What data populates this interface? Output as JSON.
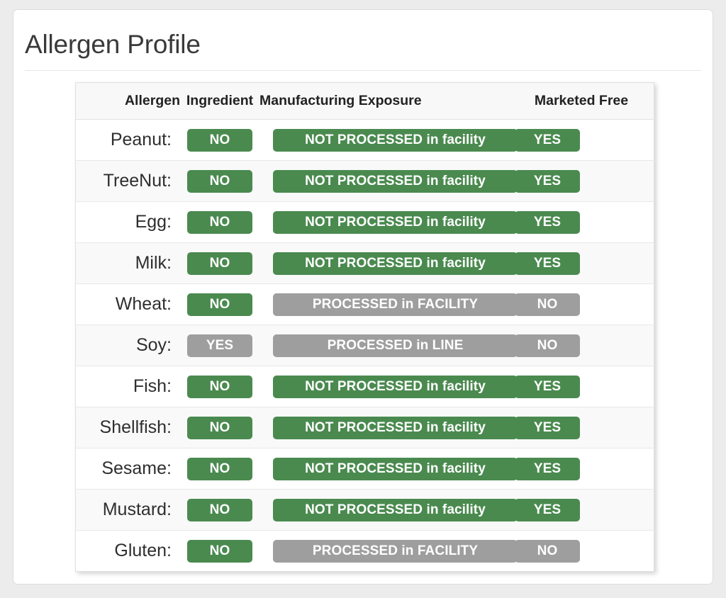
{
  "card": {
    "title": "Allergen Profile"
  },
  "table": {
    "headers": {
      "allergen": "Allergen",
      "ingredient": "Ingredient",
      "exposure": "Manufacturing Exposure",
      "marketed": "Marketed Free"
    },
    "colors": {
      "green": "#4a8a4f",
      "gray": "#9e9e9e",
      "header_bg": "#f8f8f8",
      "stripe_bg": "#f9f9f9",
      "page_bg": "#ececec",
      "card_bg": "#ffffff",
      "title_color": "#3a3a3a"
    },
    "rows": [
      {
        "allergen": "Peanut:",
        "ingredient": "NO",
        "ingredient_state": "green",
        "exposure": "NOT PROCESSED in facility",
        "exposure_state": "green",
        "marketed": "YES",
        "marketed_state": "green"
      },
      {
        "allergen": "TreeNut:",
        "ingredient": "NO",
        "ingredient_state": "green",
        "exposure": "NOT PROCESSED in facility",
        "exposure_state": "green",
        "marketed": "YES",
        "marketed_state": "green"
      },
      {
        "allergen": "Egg:",
        "ingredient": "NO",
        "ingredient_state": "green",
        "exposure": "NOT PROCESSED in facility",
        "exposure_state": "green",
        "marketed": "YES",
        "marketed_state": "green"
      },
      {
        "allergen": "Milk:",
        "ingredient": "NO",
        "ingredient_state": "green",
        "exposure": "NOT PROCESSED in facility",
        "exposure_state": "green",
        "marketed": "YES",
        "marketed_state": "green"
      },
      {
        "allergen": "Wheat:",
        "ingredient": "NO",
        "ingredient_state": "green",
        "exposure": "PROCESSED in FACILITY",
        "exposure_state": "gray",
        "marketed": "NO",
        "marketed_state": "gray"
      },
      {
        "allergen": "Soy:",
        "ingredient": "YES",
        "ingredient_state": "gray",
        "exposure": "PROCESSED in LINE",
        "exposure_state": "gray",
        "marketed": "NO",
        "marketed_state": "gray"
      },
      {
        "allergen": "Fish:",
        "ingredient": "NO",
        "ingredient_state": "green",
        "exposure": "NOT PROCESSED in facility",
        "exposure_state": "green",
        "marketed": "YES",
        "marketed_state": "green"
      },
      {
        "allergen": "Shellfish:",
        "ingredient": "NO",
        "ingredient_state": "green",
        "exposure": "NOT PROCESSED in facility",
        "exposure_state": "green",
        "marketed": "YES",
        "marketed_state": "green"
      },
      {
        "allergen": "Sesame:",
        "ingredient": "NO",
        "ingredient_state": "green",
        "exposure": "NOT PROCESSED in facility",
        "exposure_state": "green",
        "marketed": "YES",
        "marketed_state": "green"
      },
      {
        "allergen": "Mustard:",
        "ingredient": "NO",
        "ingredient_state": "green",
        "exposure": "NOT PROCESSED in facility",
        "exposure_state": "green",
        "marketed": "YES",
        "marketed_state": "green"
      },
      {
        "allergen": "Gluten:",
        "ingredient": "NO",
        "ingredient_state": "green",
        "exposure": "PROCESSED in FACILITY",
        "exposure_state": "gray",
        "marketed": "NO",
        "marketed_state": "gray"
      }
    ]
  }
}
